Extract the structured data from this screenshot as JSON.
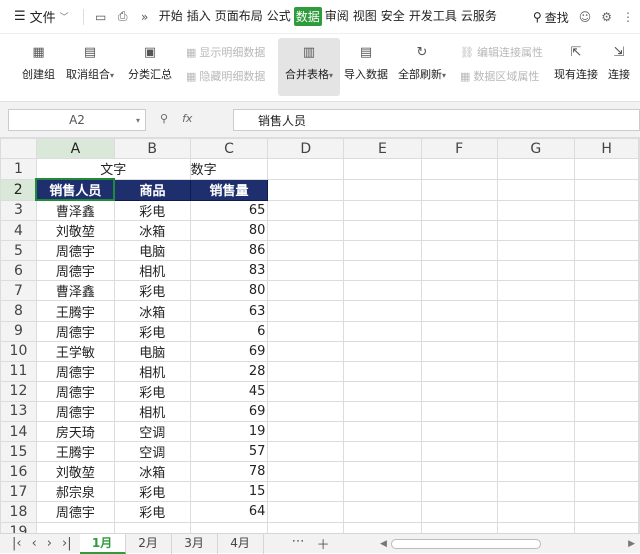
{
  "menubar": {
    "file_label": "文件",
    "tabs": [
      "开始",
      "插入",
      "页面布局",
      "公式",
      "数据",
      "审阅",
      "视图",
      "安全",
      "开发工具",
      "云服务"
    ],
    "active_tab": "数据",
    "search_label": "查找"
  },
  "ribbon": {
    "group": "创建组",
    "ungroup": "取消组合",
    "subtotal": "分类汇总",
    "show_detail": "显示明细数据",
    "hide_detail": "隐藏明细数据",
    "merge_tables": "合并表格",
    "import_data": "导入数据",
    "refresh_all": "全部刷新",
    "edit_links": "编辑连接属性",
    "range_props": "数据区域属性",
    "existing_conn": "现有连接",
    "connect": "连接"
  },
  "formula_bar": {
    "name_box": "A2",
    "fx_label": "fx",
    "content": "销售人员"
  },
  "columns": [
    "A",
    "B",
    "C",
    "D",
    "E",
    "F",
    "G",
    "H"
  ],
  "selected_column": "A",
  "row_numbers": [
    "1",
    "2",
    "3",
    "4",
    "5",
    "6",
    "7",
    "8",
    "9",
    "10",
    "11",
    "12",
    "13",
    "14",
    "15",
    "16",
    "17",
    "18",
    "19"
  ],
  "row1": {
    "merged_ab": "文字",
    "c": "数字"
  },
  "header_row": {
    "a": "销售人员",
    "b": "商品",
    "c": "销售量"
  },
  "rows": [
    [
      "曹泽鑫",
      "彩电",
      "65"
    ],
    [
      "刘敬堃",
      "冰箱",
      "80"
    ],
    [
      "周德宇",
      "电脑",
      "86"
    ],
    [
      "周德宇",
      "相机",
      "83"
    ],
    [
      "曹泽鑫",
      "彩电",
      "80"
    ],
    [
      "王腾宇",
      "冰箱",
      "63"
    ],
    [
      "周德宇",
      "彩电",
      "6"
    ],
    [
      "王学敏",
      "电脑",
      "69"
    ],
    [
      "周德宇",
      "相机",
      "28"
    ],
    [
      "周德宇",
      "彩电",
      "45"
    ],
    [
      "周德宇",
      "相机",
      "69"
    ],
    [
      "房天琦",
      "空调",
      "19"
    ],
    [
      "王腾宇",
      "空调",
      "57"
    ],
    [
      "刘敬堃",
      "冰箱",
      "78"
    ],
    [
      "郝宗泉",
      "彩电",
      "15"
    ],
    [
      "周德宇",
      "彩电",
      "64"
    ]
  ],
  "sheets": [
    "1月",
    "2月",
    "3月",
    "4月"
  ],
  "active_sheet": "1月"
}
